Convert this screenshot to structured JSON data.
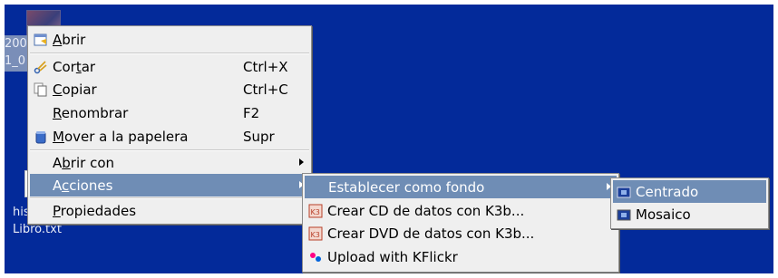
{
  "desktop": {
    "background_color": "#032a9a",
    "icon_labels": {
      "line1": "200",
      "line2": "1_0",
      "line3": "his",
      "line4": "Libro.txt"
    }
  },
  "context_menu": {
    "items": [
      {
        "pre": "",
        "ul": "A",
        "post": "brir",
        "shortcut": "",
        "icon": "open-document-icon"
      },
      {
        "pre": "Cor",
        "ul": "t",
        "post": "ar",
        "shortcut": "Ctrl+X",
        "icon": "scissors-icon"
      },
      {
        "pre": "",
        "ul": "C",
        "post": "opiar",
        "shortcut": "Ctrl+C",
        "icon": "copy-icon"
      },
      {
        "pre": "",
        "ul": "R",
        "post": "enombrar",
        "shortcut": "F2",
        "icon": ""
      },
      {
        "pre": "",
        "ul": "M",
        "post": "over a la papelera",
        "shortcut": "Supr",
        "icon": "trash-icon"
      },
      {
        "pre": "A",
        "ul": "b",
        "post": "rir con",
        "shortcut": "",
        "icon": "",
        "submenu": true
      },
      {
        "pre": "A",
        "ul": "c",
        "post": "ciones",
        "shortcut": "",
        "icon": "",
        "submenu": true,
        "active": true
      },
      {
        "pre": "",
        "ul": "P",
        "post": "ropiedades",
        "shortcut": "",
        "icon": ""
      }
    ]
  },
  "acciones_submenu": {
    "items": [
      {
        "label": "Establecer como fondo",
        "icon": "",
        "submenu": true,
        "active": true
      },
      {
        "label": "Crear CD de datos con K3b...",
        "icon": "k3b-icon"
      },
      {
        "label": "Crear DVD de datos con K3b...",
        "icon": "k3b-icon"
      },
      {
        "label": "Upload with KFlickr",
        "icon": "flickr-icon"
      }
    ]
  },
  "fondo_submenu": {
    "items": [
      {
        "label": "Centrado",
        "icon": "wallpaper-icon",
        "active": true
      },
      {
        "label": "Mosaico",
        "icon": "wallpaper-icon"
      }
    ]
  },
  "colors": {
    "highlight": "#6f8db5",
    "menu_background": "#efefef"
  }
}
